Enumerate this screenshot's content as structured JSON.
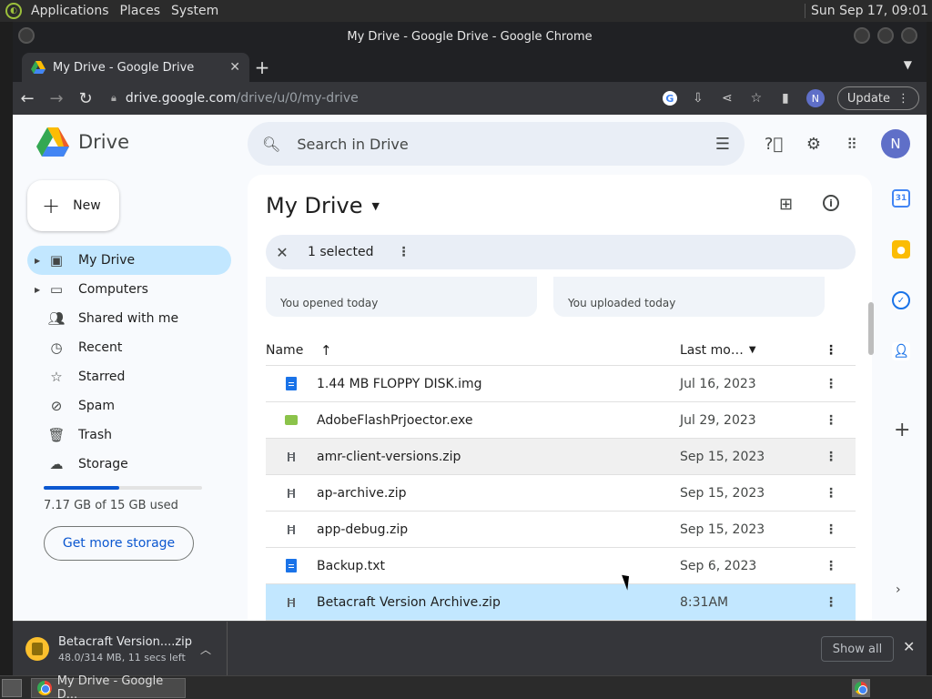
{
  "desktop": {
    "menus": [
      "Applications",
      "Places",
      "System"
    ],
    "clock": "Sun Sep 17, 09:01"
  },
  "window": {
    "title": "My Drive - Google Drive - Google Chrome"
  },
  "tab": {
    "title": "My Drive - Google Drive",
    "close": "✕",
    "new": "+"
  },
  "omnibox": {
    "host": "drive.google.com",
    "path": "/drive/u/0/my-drive",
    "avatar": "N",
    "update_label": "Update"
  },
  "drive": {
    "brand": "Drive",
    "search_placeholder": "Search in Drive",
    "avatar": "N",
    "new_label": "New",
    "sidebar": [
      {
        "label": "My Drive",
        "icon": "my-drive-icon",
        "active": true
      },
      {
        "label": "Computers",
        "icon": "computers-icon"
      },
      {
        "label": "Shared with me",
        "icon": "shared-icon"
      },
      {
        "label": "Recent",
        "icon": "clock-icon"
      },
      {
        "label": "Starred",
        "icon": "star-icon"
      },
      {
        "label": "Spam",
        "icon": "spam-icon"
      },
      {
        "label": "Trash",
        "icon": "trash-icon"
      },
      {
        "label": "Storage",
        "icon": "cloud-icon"
      }
    ],
    "storage": {
      "used_text": "7.17 GB of 15 GB used",
      "fraction": 0.478
    },
    "get_more_label": "Get more storage",
    "page_title": "My Drive",
    "selection": {
      "count_label": "1 selected"
    },
    "suggestions": [
      "You opened today",
      "You uploaded today"
    ],
    "columns": {
      "name": "Name",
      "last_modified": "Last mo…"
    },
    "files": [
      {
        "name": "1.44 MB FLOPPY DISK.img",
        "date": "Jul 16, 2023",
        "type": "doc"
      },
      {
        "name": "AdobeFlashPrjoector.exe",
        "date": "Jul 29, 2023",
        "type": "exe"
      },
      {
        "name": "amr-client-versions.zip",
        "date": "Sep 15, 2023",
        "type": "zip",
        "state": "hover"
      },
      {
        "name": "ap-archive.zip",
        "date": "Sep 15, 2023",
        "type": "zip"
      },
      {
        "name": "app-debug.zip",
        "date": "Sep 15, 2023",
        "type": "zip"
      },
      {
        "name": "Backup.txt",
        "date": "Sep 6, 2023",
        "type": "doc"
      },
      {
        "name": "Betacraft Version Archive.zip",
        "date": "8:31AM",
        "type": "zip",
        "state": "selected"
      }
    ]
  },
  "download": {
    "name": "Betacraft Version....zip",
    "status": "48.0/314 MB, 11 secs left",
    "show_all": "Show all"
  },
  "taskbar": {
    "task_label": "My Drive - Google D..."
  },
  "colors": {
    "accent": "#0b57d0",
    "selected": "#c2e7ff",
    "search_bg": "#e9eef6"
  }
}
